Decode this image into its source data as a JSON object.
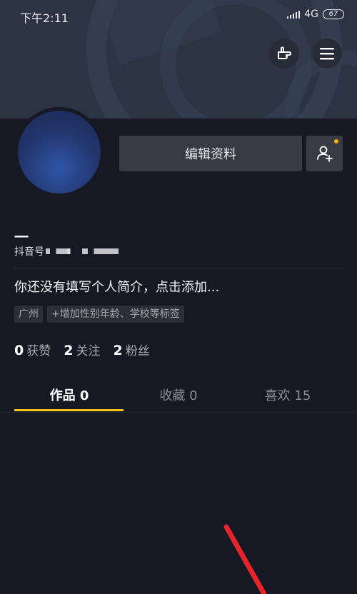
{
  "status_bar": {
    "time": "下午2:11",
    "network": "4G",
    "battery": "67"
  },
  "header": {
    "background_color": "#2c3444",
    "hand_icon": "pointing-hand-icon",
    "menu_icon": "hamburger-menu-icon"
  },
  "profile": {
    "nickname": "一",
    "douyin_id_prefix": "抖音号",
    "bio": "你还没有填写个人简介，点击添加..."
  },
  "buttons": {
    "edit_profile": "编辑资料",
    "add_friend_icon": "add-friend-icon"
  },
  "tags": [
    {
      "label": "广州"
    },
    {
      "label": "+增加性别年龄、学校等标签"
    }
  ],
  "stats": [
    {
      "value": "0",
      "label": "获赞"
    },
    {
      "value": "2",
      "label": "关注"
    },
    {
      "value": "2",
      "label": "粉丝"
    }
  ],
  "tabs": [
    {
      "label": "作品 0",
      "active": true
    },
    {
      "label": "收藏 0",
      "active": false
    },
    {
      "label": "喜欢 15",
      "active": false
    }
  ],
  "colors": {
    "background": "#161823",
    "accent": "#f5c51c",
    "annotation_arrow": "#e8242b"
  }
}
